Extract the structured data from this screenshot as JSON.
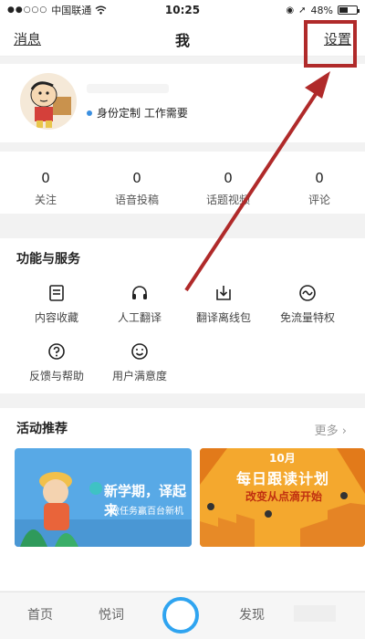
{
  "status_bar": {
    "carrier": "中国联通",
    "time": "10:25",
    "battery": "48%",
    "battery_level": 0.48
  },
  "nav": {
    "left": "消息",
    "title": "我",
    "right": "设置"
  },
  "profile": {
    "tag": "身份定制 工作需要"
  },
  "stats": [
    {
      "value": "0",
      "label": "关注"
    },
    {
      "value": "0",
      "label": "语音投稿"
    },
    {
      "value": "0",
      "label": "话题视频"
    },
    {
      "value": "0",
      "label": "评论"
    }
  ],
  "services": {
    "title": "功能与服务",
    "items": [
      {
        "label": "内容收藏",
        "icon": "bookmark-icon"
      },
      {
        "label": "人工翻译",
        "icon": "headset-icon"
      },
      {
        "label": "翻译离线包",
        "icon": "download-icon"
      },
      {
        "label": "免流量特权",
        "icon": "wave-icon"
      },
      {
        "label": "反馈与帮助",
        "icon": "help-icon"
      },
      {
        "label": "用户满意度",
        "icon": "smile-icon"
      }
    ]
  },
  "activities": {
    "title": "活动推荐",
    "more": "更多",
    "banner1": {
      "title": "新学期，译起来",
      "subtitle": "做任务赢百台新机"
    },
    "banner2": {
      "top": "10月",
      "title": "每日跟读计划",
      "subtitle": "改变从点滴开始"
    }
  },
  "tabbar": {
    "home": "首页",
    "vocab": "悦词",
    "discover": "发现"
  },
  "colors": {
    "annotation_red": "#b02a2a",
    "accent_blue": "#2fa4f0"
  }
}
